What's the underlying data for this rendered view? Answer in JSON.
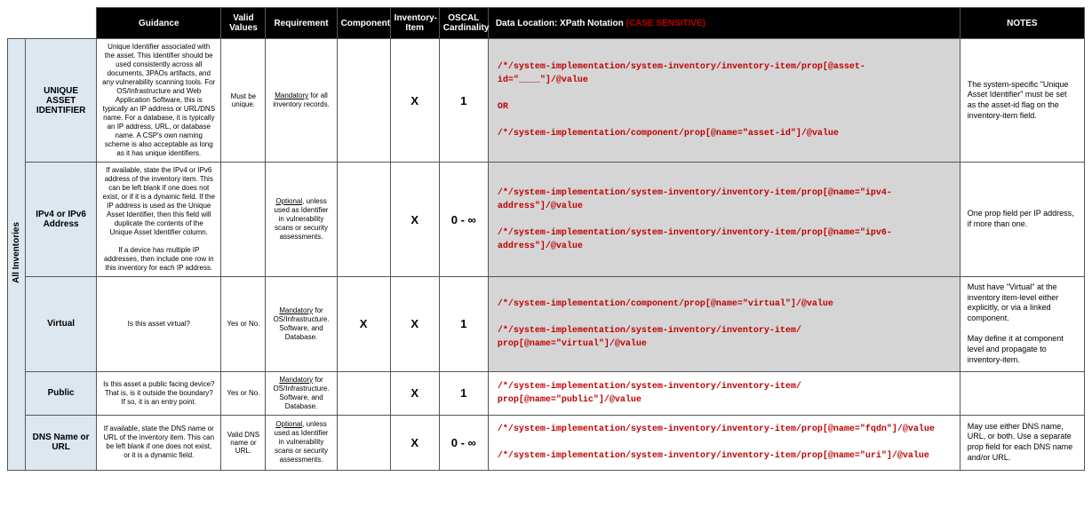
{
  "headers": {
    "guidance": "Guidance",
    "valid": "Valid Values",
    "req": "Requirement",
    "comp": "Component",
    "inv": "Inventory-Item",
    "card": "OSCAL Cardinality",
    "xpath_prefix": "Data Location: XPath Notation ",
    "xpath_sens": "(CASE SENSITIVE)",
    "notes": "NOTES"
  },
  "side": "All Inventories",
  "rows": [
    {
      "label": "UNIQUE ASSET IDENTIFIER",
      "guidance": "Unique Identifier associated with the asset. This Identifier should be used consistently across all documents, 3PAOs artifacts, and any vulnerability scanning tools. For OS/Infrastructure and Web Application Software, this is typically an IP address or URL/DNS name. For a database, it is typically an IP address, URL, or database name. A CSP's own naming scheme is also acceptable as long as it has unique identifiers.",
      "valid": "Must be unique.",
      "req_u": "Mandatory",
      "req_t": " for all inventory records.",
      "comp": "",
      "inv": "X",
      "card": "1",
      "xpath1": "/*/system-implementation/system-inventory/inventory-item/prop[@asset-id=\"____\"]/@value",
      "or": "OR",
      "xpath2": "/*/system-implementation/component/prop[@name=\"asset-id\"]/@value",
      "gray": true,
      "notes": "The system-specific \"Unique Asset Identifier\" must be set as the asset-id flag on the inventory-item field."
    },
    {
      "label": "IPv4 or IPv6 Address",
      "guidance": "If available, state the IPv4 or IPv6 address of the inventory item. This can be left blank if one does not exist, or if it is a dynamic field. If the IP address is used as the Unique Asset Identifier, then this field will duplicate the contents of the Unique Asset Identifier column.\n\nIf a device has multiple IP addresses, then include one row in this inventory for each IP address.",
      "valid": "",
      "req_u": "Optional",
      "req_t": ", unless used as Identifier in vulnerability scans or security assessments.",
      "comp": "",
      "inv": "X",
      "card": "0 - ∞",
      "xpath1": "/*/system-implementation/system-inventory/inventory-item/prop[@name=\"ipv4-address\"]/@value",
      "xpath2": "/*/system-implementation/system-inventory/inventory-item/prop[@name=\"ipv6-address\"]/@value",
      "gray": true,
      "notes": "One prop field per IP address, if more than one."
    },
    {
      "label": "Virtual",
      "guidance": "Is this asset virtual?",
      "valid": "Yes or No.",
      "req_u": "Mandatory",
      "req_t": " for OS/Infrastructure. Software, and Database.",
      "comp": "X",
      "inv": "X",
      "card": "1",
      "xpath1": "/*/system-implementation/component/prop[@name=\"virtual\"]/@value",
      "xpath2": "/*/system-implementation/system-inventory/inventory-item/ prop[@name=\"virtual\"]/@value",
      "gray": true,
      "notes": "Must have \"Virtual\" at the inventory item-level either explicitly, or via a linked component.\n\nMay define it at component level and propagate to inventory-item."
    },
    {
      "label": "Public",
      "guidance": "Is this asset a public facing device? That is, is it outside the boundary? If so, it is an entry point.",
      "valid": "Yes or No.",
      "req_u": "Mandatory",
      "req_t": " for OS/Infrastructure. Software, and Database.",
      "comp": "",
      "inv": "X",
      "card": "1",
      "xpath1": "/*/system-implementation/system-inventory/inventory-item/ prop[@name=\"public\"]/@value",
      "gray": false,
      "notes": ""
    },
    {
      "label": "DNS Name or URL",
      "guidance": "If available, state the DNS name or URL of the inventory item. This can be left blank if one does not exist, or it is a dynamic field.",
      "valid": "Valid DNS name or URL.",
      "req_u": "Optional",
      "req_t": ", unless used as Identifier in vulnerability scans or security assessments.",
      "comp": "",
      "inv": "X",
      "card": "0 - ∞",
      "xpath1": "/*/system-implementation/system-inventory/inventory-item/prop[@name=\"fqdn\"]/@value",
      "xpath2": "/*/system-implementation/system-inventory/inventory-item/prop[@name=\"uri\"]/@value",
      "gray": false,
      "notes": "May use either DNS name, URL, or both. Use a separate prop field for each DNS name and/or URL."
    }
  ]
}
